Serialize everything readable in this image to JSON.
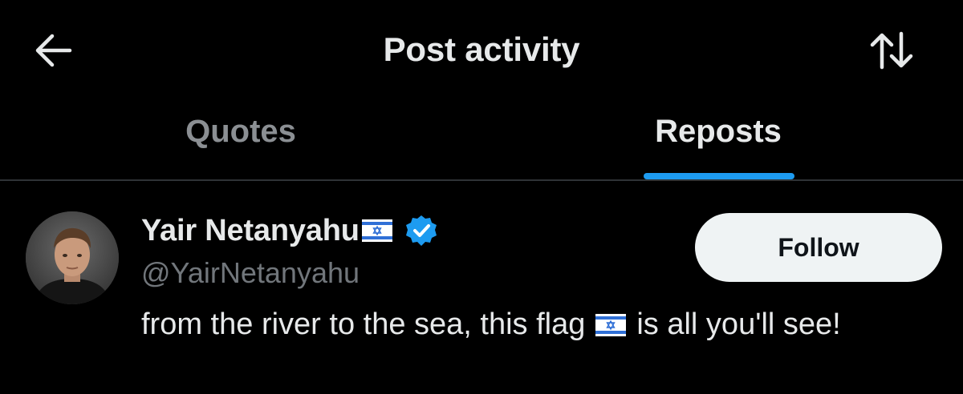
{
  "header": {
    "title": "Post activity",
    "back_icon": "arrow-left-icon",
    "sort_icon": "sort-arrows-icon"
  },
  "tabs": [
    {
      "label": "Quotes",
      "selected": false
    },
    {
      "label": "Reposts",
      "selected": true
    }
  ],
  "user": {
    "display_name": "Yair Netanyahu",
    "name_emoji": "israel-flag-icon",
    "verified_icon": "verified-badge-icon",
    "handle": "@YairNetanyahu",
    "bio_before": "from the river to the sea, this flag",
    "bio_emoji": "israel-flag-icon",
    "bio_after": "is all you'll see!",
    "follow_label": "Follow"
  },
  "colors": {
    "background": "#000000",
    "text_primary": "#e7e9ea",
    "text_secondary": "#71767b",
    "accent": "#1d9bf0",
    "follow_button_bg": "#eff3f4"
  }
}
